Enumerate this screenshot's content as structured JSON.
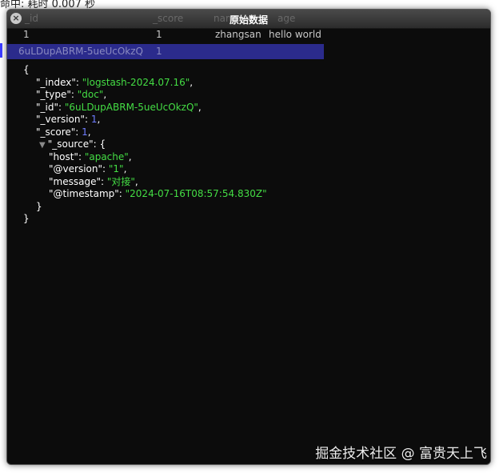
{
  "background_page": {
    "status_text": "命中: 耗时 0.007 秒",
    "column_headers": [
      "_id",
      "_score",
      "name",
      "age"
    ],
    "row_first": [
      "1",
      "1",
      "zhangsan",
      "hello world"
    ],
    "row_selected": [
      "6uLDupABRM-5ueUcOkzQ",
      "1"
    ]
  },
  "dialog": {
    "title": "原始数据",
    "close_glyph": "×",
    "json": {
      "open_brace": "{",
      "close_brace": "}",
      "index_key": "\"_index\":",
      "index_value": "\"logstash-2024.07.16\"",
      "type_key": "\"_type\":",
      "type_value": "\"doc\"",
      "id_key": "\"_id\":",
      "id_value": "\"6uLDupABRM-5ueUcOkzQ\"",
      "version_key": "\"_version\":",
      "version_value": "1",
      "score_key": "\"_score\":",
      "score_value": "1",
      "source_key": "\"_source\":",
      "source_open": "{",
      "source_close": "}",
      "toggle_glyph": "▼",
      "host_key": "\"host\":",
      "host_value": "\"apache\"",
      "atversion_key": "\"@version\":",
      "atversion_value": "\"1\"",
      "message_key": "\"message\":",
      "message_value": "\"对接\"",
      "timestamp_key": "\"@timestamp\":",
      "timestamp_value": "\"2024-07-16T08:57:54.830Z\"",
      "comma": ","
    }
  },
  "watermark": "掘金技术社区 @ 富贵天上飞",
  "colors": {
    "dialog_bg": "#0c0c0c",
    "string_value": "#44dd44",
    "number_value": "#6f7dff",
    "key_text": "#ffffff",
    "selected_row": "#2b2b8c"
  }
}
